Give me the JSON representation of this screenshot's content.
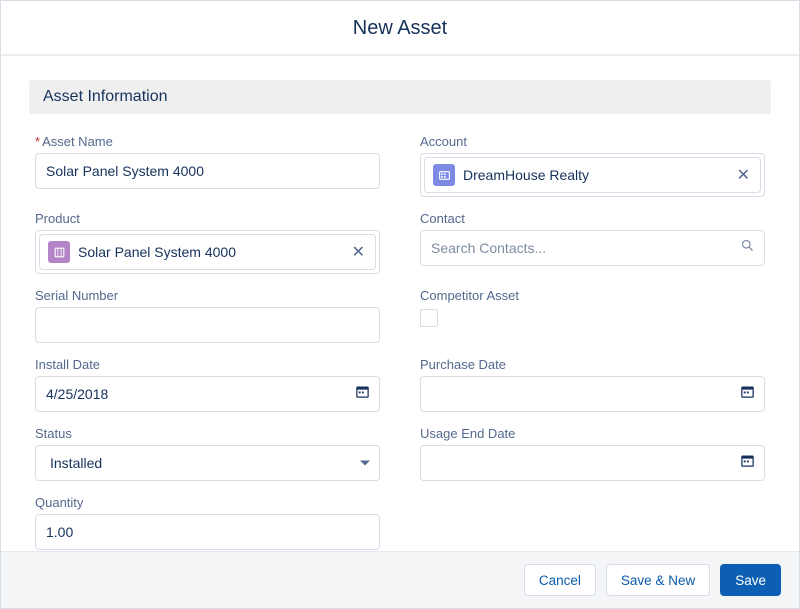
{
  "modal": {
    "title": "New Asset"
  },
  "section": {
    "heading": "Asset Information"
  },
  "fields": {
    "assetName": {
      "label": "Asset Name",
      "value": "Solar Panel System 4000"
    },
    "account": {
      "label": "Account",
      "pillText": "DreamHouse Realty",
      "iconBg": "#7e8be4"
    },
    "product": {
      "label": "Product",
      "pillText": "Solar Panel System 4000",
      "iconBg": "#b483c8"
    },
    "contact": {
      "label": "Contact",
      "placeholder": "Search Contacts..."
    },
    "serial": {
      "label": "Serial Number",
      "value": ""
    },
    "competitor": {
      "label": "Competitor Asset"
    },
    "installDate": {
      "label": "Install Date",
      "value": "4/25/2018"
    },
    "purchaseDate": {
      "label": "Purchase Date",
      "value": ""
    },
    "status": {
      "label": "Status",
      "value": "Installed"
    },
    "usageEnd": {
      "label": "Usage End Date",
      "value": ""
    },
    "quantity": {
      "label": "Quantity",
      "value": "1.00"
    }
  },
  "footer": {
    "cancel": "Cancel",
    "saveNew": "Save & New",
    "save": "Save"
  }
}
